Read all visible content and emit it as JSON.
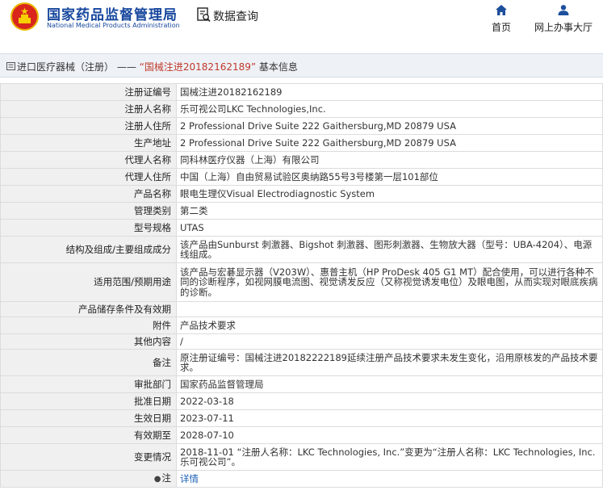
{
  "header": {
    "org_name_cn": "国家药品监督管理局",
    "org_name_en": "National Medical Products Administration",
    "search_label": "数据查询",
    "nav": [
      {
        "label": "首页",
        "icon": "home-icon"
      },
      {
        "label": "网上办事大厅",
        "icon": "user-icon"
      }
    ]
  },
  "breadcrumb": {
    "category": "进口医疗器械（注册）",
    "separator": "——",
    "reg_no_quoted": "“国械注进20182162189”",
    "suffix": "基本信息"
  },
  "rows": [
    {
      "label": "注册证编号",
      "value": "国械注进20182162189"
    },
    {
      "label": "注册人名称",
      "value": "乐可视公司LKC Technologies,Inc."
    },
    {
      "label": "注册人住所",
      "value": "2 Professional Drive Suite 222 Gaithersburg,MD 20879 USA"
    },
    {
      "label": "生产地址",
      "value": "2 Professional Drive Suite 222 Gaithersburg,MD 20879 USA"
    },
    {
      "label": "代理人名称",
      "value": "同科林医疗仪器（上海）有限公司"
    },
    {
      "label": "代理人住所",
      "value": "中国（上海）自由贸易试验区奥纳路55号3号楼第一层101部位"
    },
    {
      "label": "产品名称",
      "value": "眼电生理仪Visual Electrodiagnostic System"
    },
    {
      "label": "管理类别",
      "value": "第二类"
    },
    {
      "label": "型号规格",
      "value": "UTAS"
    },
    {
      "label": "结构及组成/主要组成成分",
      "value": "该产品由Sunburst 刺激器、Bigshot 刺激器、图形刺激器、生物放大器（型号：UBA-4204）、电源线组成。"
    },
    {
      "label": "适用范围/预期用途",
      "value": "该产品与宏碁显示器（V203W）、惠普主机（HP ProDesk 405 G1 MT）配合使用，可以进行各种不同的诊断程序，如视网膜电流图、视觉诱发反应（又称视觉诱发电位）及眼电图，从而实现对眼底疾病的诊断。"
    },
    {
      "label": "产品储存条件及有效期",
      "value": ""
    },
    {
      "label": "附件",
      "value": "产品技术要求"
    },
    {
      "label": "其他内容",
      "value": "/"
    },
    {
      "label": "备注",
      "value": "原注册证编号：国械注进20182222189延续注册产品技术要求未发生变化，沿用原核发的产品技术要求。"
    },
    {
      "label": "审批部门",
      "value": "国家药品监督管理局"
    },
    {
      "label": "批准日期",
      "value": "2022-03-18"
    },
    {
      "label": "生效日期",
      "value": "2023-07-11"
    },
    {
      "label": "有效期至",
      "value": "2028-07-10"
    },
    {
      "label": "变更情况",
      "value": "2018-11-01 “注册人名称：LKC Technologies, Inc.”变更为“注册人名称：LKC Technologies, Inc. 乐可视公司”。"
    }
  ],
  "note_row": {
    "label": "注",
    "icon": "lightbulb-icon",
    "link": "详情"
  },
  "colors": {
    "brand_blue": "#17479e",
    "link_blue": "#1a5fb4",
    "label_bg": "#f0f0f0",
    "bar_bg": "#eef2f7"
  }
}
